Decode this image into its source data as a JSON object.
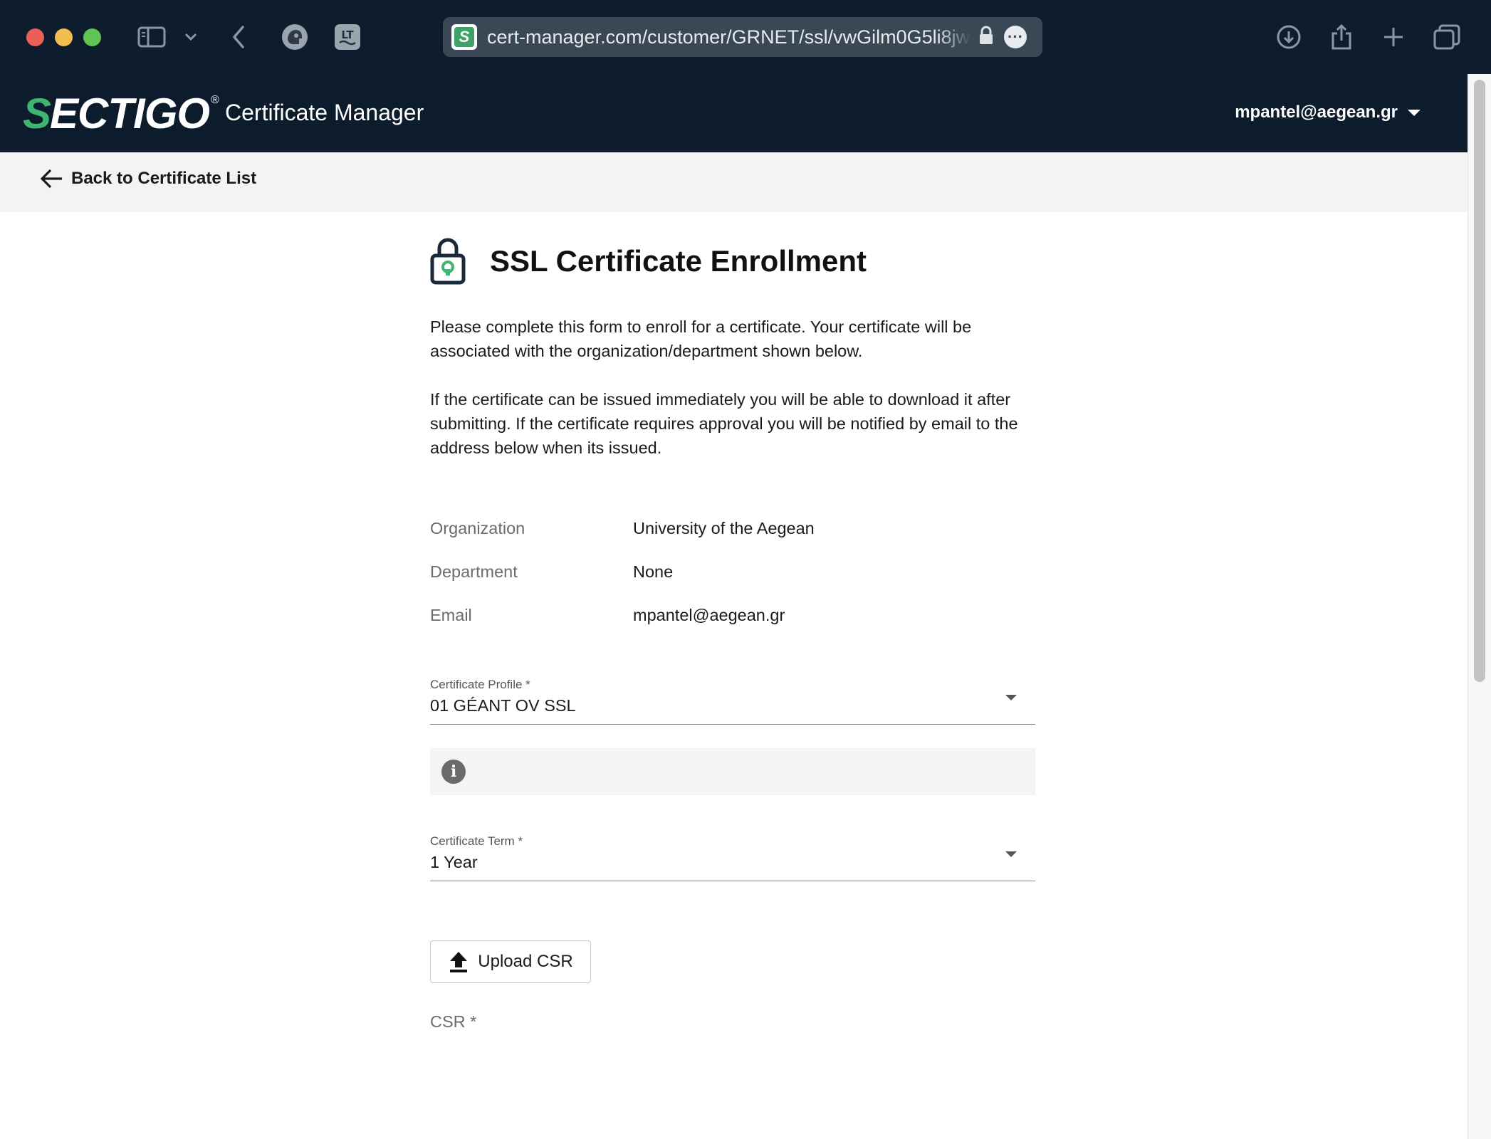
{
  "browser": {
    "url": "cert-manager.com/customer/GRNET/ssl/vwGilm0G5li8jw",
    "favicon_letter": "S"
  },
  "header": {
    "logo_first_letter": "S",
    "logo_rest": "ECTIGO",
    "logo_registered": "®",
    "app_title": "Certificate Manager",
    "user_email": "mpantel@aegean.gr"
  },
  "subbar": {
    "back_label": "Back to Certificate List"
  },
  "page": {
    "title": "SSL Certificate Enrollment",
    "intro_paragraph_1": "Please complete this form to enroll for a certificate. Your certificate will be associated with the organization/department shown below.",
    "intro_paragraph_2": "If the certificate can be issued immediately you will be able to download it after submitting. If the certificate requires approval you will be notified by email to the address below when its issued."
  },
  "details": [
    {
      "label": "Organization",
      "value": "University of the Aegean"
    },
    {
      "label": "Department",
      "value": "None"
    },
    {
      "label": "Email",
      "value": "mpantel@aegean.gr"
    }
  ],
  "form": {
    "profile_label": "Certificate Profile *",
    "profile_value": "01 GÉANT OV SSL",
    "info_icon_glyph": "i",
    "term_label": "Certificate Term *",
    "term_value": "1 Year",
    "upload_label": "Upload CSR",
    "csr_label": "CSR *"
  },
  "colors": {
    "header_bg": "#0c1c2c",
    "brand_green": "#3fb571",
    "subbar_bg": "#f3f3f3"
  }
}
